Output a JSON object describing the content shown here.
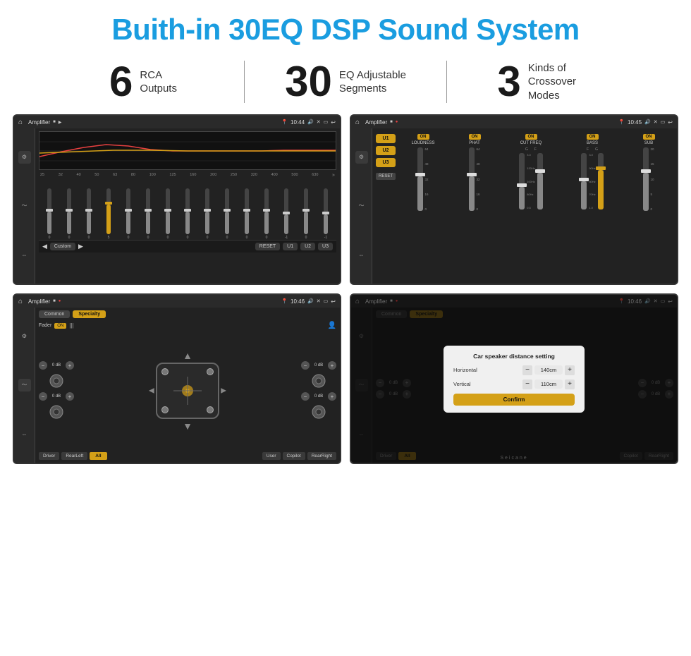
{
  "header": {
    "title": "Buith-in 30EQ DSP Sound System"
  },
  "stats": [
    {
      "number": "6",
      "label": "RCA\nOutputs"
    },
    {
      "number": "30",
      "label": "EQ Adjustable\nSegments"
    },
    {
      "number": "3",
      "label": "Kinds of\nCrossover Modes"
    }
  ],
  "screens": {
    "screen1": {
      "title": "Amplifier",
      "time": "10:44",
      "freqs": [
        "25",
        "32",
        "40",
        "50",
        "63",
        "80",
        "100",
        "125",
        "160",
        "200",
        "250",
        "320",
        "400",
        "500",
        "630"
      ],
      "values": [
        "0",
        "0",
        "0",
        "5",
        "0",
        "0",
        "0",
        "0",
        "0",
        "0",
        "0",
        "0",
        "-1",
        "0",
        "-1"
      ],
      "buttons": [
        "Custom",
        "RESET",
        "U1",
        "U2",
        "U3"
      ]
    },
    "screen2": {
      "title": "Amplifier",
      "time": "10:45",
      "u_buttons": [
        "U1",
        "U2",
        "U3"
      ],
      "channels": [
        "LOUDNESS",
        "PHAT",
        "CUT FREQ",
        "BASS",
        "SUB"
      ],
      "reset": "RESET"
    },
    "screen3": {
      "title": "Amplifier",
      "time": "10:46",
      "tabs": [
        "Common",
        "Specialty"
      ],
      "fader_label": "Fader",
      "fader_on": "ON",
      "buttons": [
        "Driver",
        "RearLeft",
        "All",
        "User",
        "Copilot",
        "RearRight"
      ],
      "db_rows": [
        "0 dB",
        "0 dB",
        "0 dB",
        "0 dB"
      ]
    },
    "screen4": {
      "title": "Amplifier",
      "time": "10:46",
      "tabs": [
        "Common",
        "Specialty"
      ],
      "fader_on": "ON",
      "dialog": {
        "title": "Car speaker distance setting",
        "horizontal_label": "Horizontal",
        "horizontal_value": "140cm",
        "vertical_label": "Vertical",
        "vertical_value": "110cm",
        "confirm_label": "Confirm",
        "db_value": "0 dB"
      },
      "buttons": [
        "Driver",
        "RearLeft",
        "User",
        "Copilot",
        "RearRight"
      ]
    }
  },
  "watermark": "Seicane"
}
